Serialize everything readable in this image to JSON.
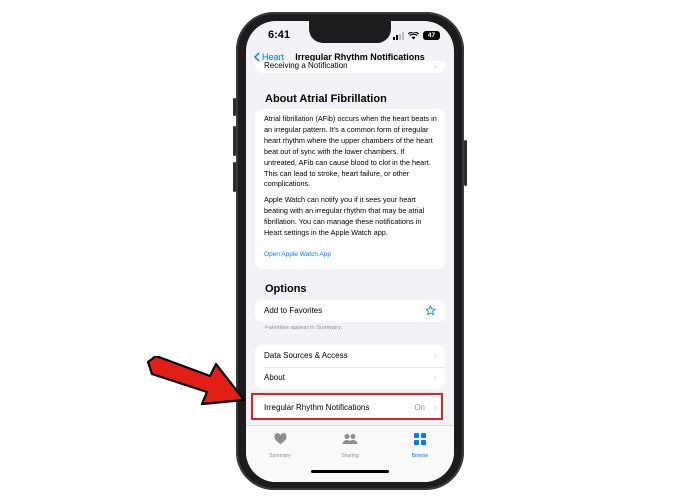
{
  "status_bar": {
    "time": "6:41",
    "battery": "47"
  },
  "nav": {
    "back_label": "Heart",
    "title": "Irregular Rhythm Notifications"
  },
  "prev_row": {
    "label": "Receiving a Notification"
  },
  "about": {
    "heading": "About Atrial Fibrillation",
    "paragraph1": "Atrial fibrillation (AFib) occurs when the heart beats in an irregular pattern. It's a common form of irregular heart rhythm where the upper chambers of the heart beat out of sync with the lower chambers. If untreated, AFib can cause blood to clot in the heart. This can lead to stroke, heart failure, or other complications.",
    "paragraph2": "Apple Watch can notify you if it sees your heart beating with an irregular rhythm that may be atrial fibrillation. You can manage these notifications in Heart settings in the Apple Watch app.",
    "link": "Open Apple Watch App"
  },
  "options": {
    "heading": "Options",
    "favorites_label": "Add to Favorites",
    "favorites_footnote": "Favorites appear in Summary.",
    "data_sources_label": "Data Sources & Access",
    "about_label": "About",
    "irregular_label": "Irregular Rhythm Notifications",
    "irregular_value": "On"
  },
  "tabbar": [
    {
      "label": "Summary",
      "icon": "heart-icon"
    },
    {
      "label": "Sharing",
      "icon": "people-icon"
    },
    {
      "label": "Browse",
      "icon": "grid-icon"
    }
  ],
  "colors": {
    "accent": "#007aff",
    "highlight": "#d6262b",
    "arrow": "#e31e17"
  }
}
